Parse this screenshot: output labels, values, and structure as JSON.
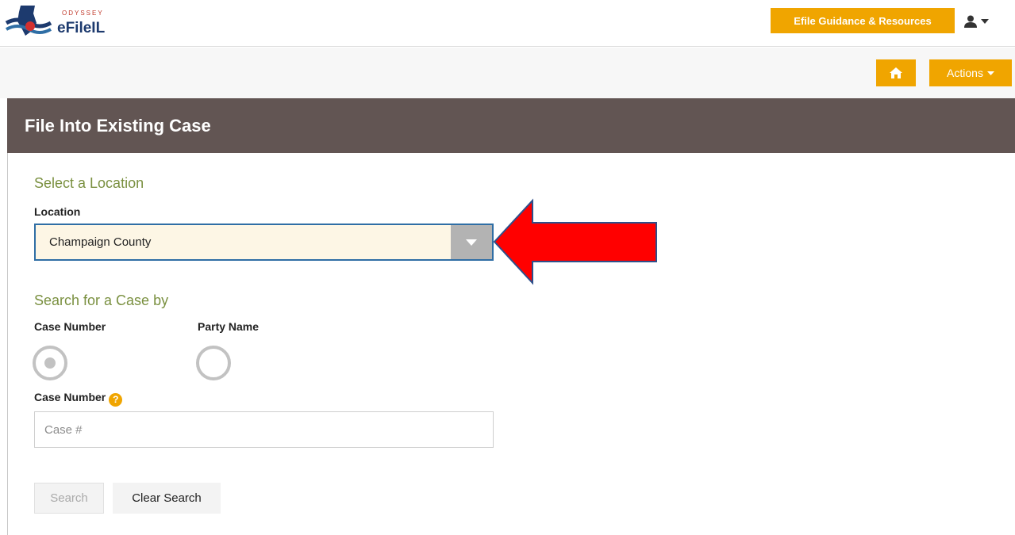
{
  "header": {
    "logo_small": "ODYSSEY",
    "logo_big": "eFileIL",
    "guidance_button": "Efile Guidance & Resources",
    "user_icon": "user-icon"
  },
  "toolbar": {
    "home_icon": "home-icon",
    "actions_label": "Actions"
  },
  "panel": {
    "title": "File Into Existing Case"
  },
  "location_section": {
    "heading": "Select a Location",
    "label": "Location",
    "selected_value": "Champaign County"
  },
  "search_section": {
    "heading": "Search for a Case by",
    "options": [
      {
        "label": "Case Number",
        "selected": true
      },
      {
        "label": "Party Name",
        "selected": false
      }
    ],
    "case_number_label": "Case Number",
    "help_icon": "?",
    "case_number_placeholder": "Case #",
    "search_button": "Search",
    "clear_button": "Clear Search"
  },
  "annotation": {
    "arrow_color": "#ff0000",
    "arrow_icon": "left-arrow-annotation"
  },
  "colors": {
    "accent": "#f0a500",
    "panel_header": "#625553",
    "section_heading": "#7a9040",
    "select_border": "#2f6ea5"
  }
}
